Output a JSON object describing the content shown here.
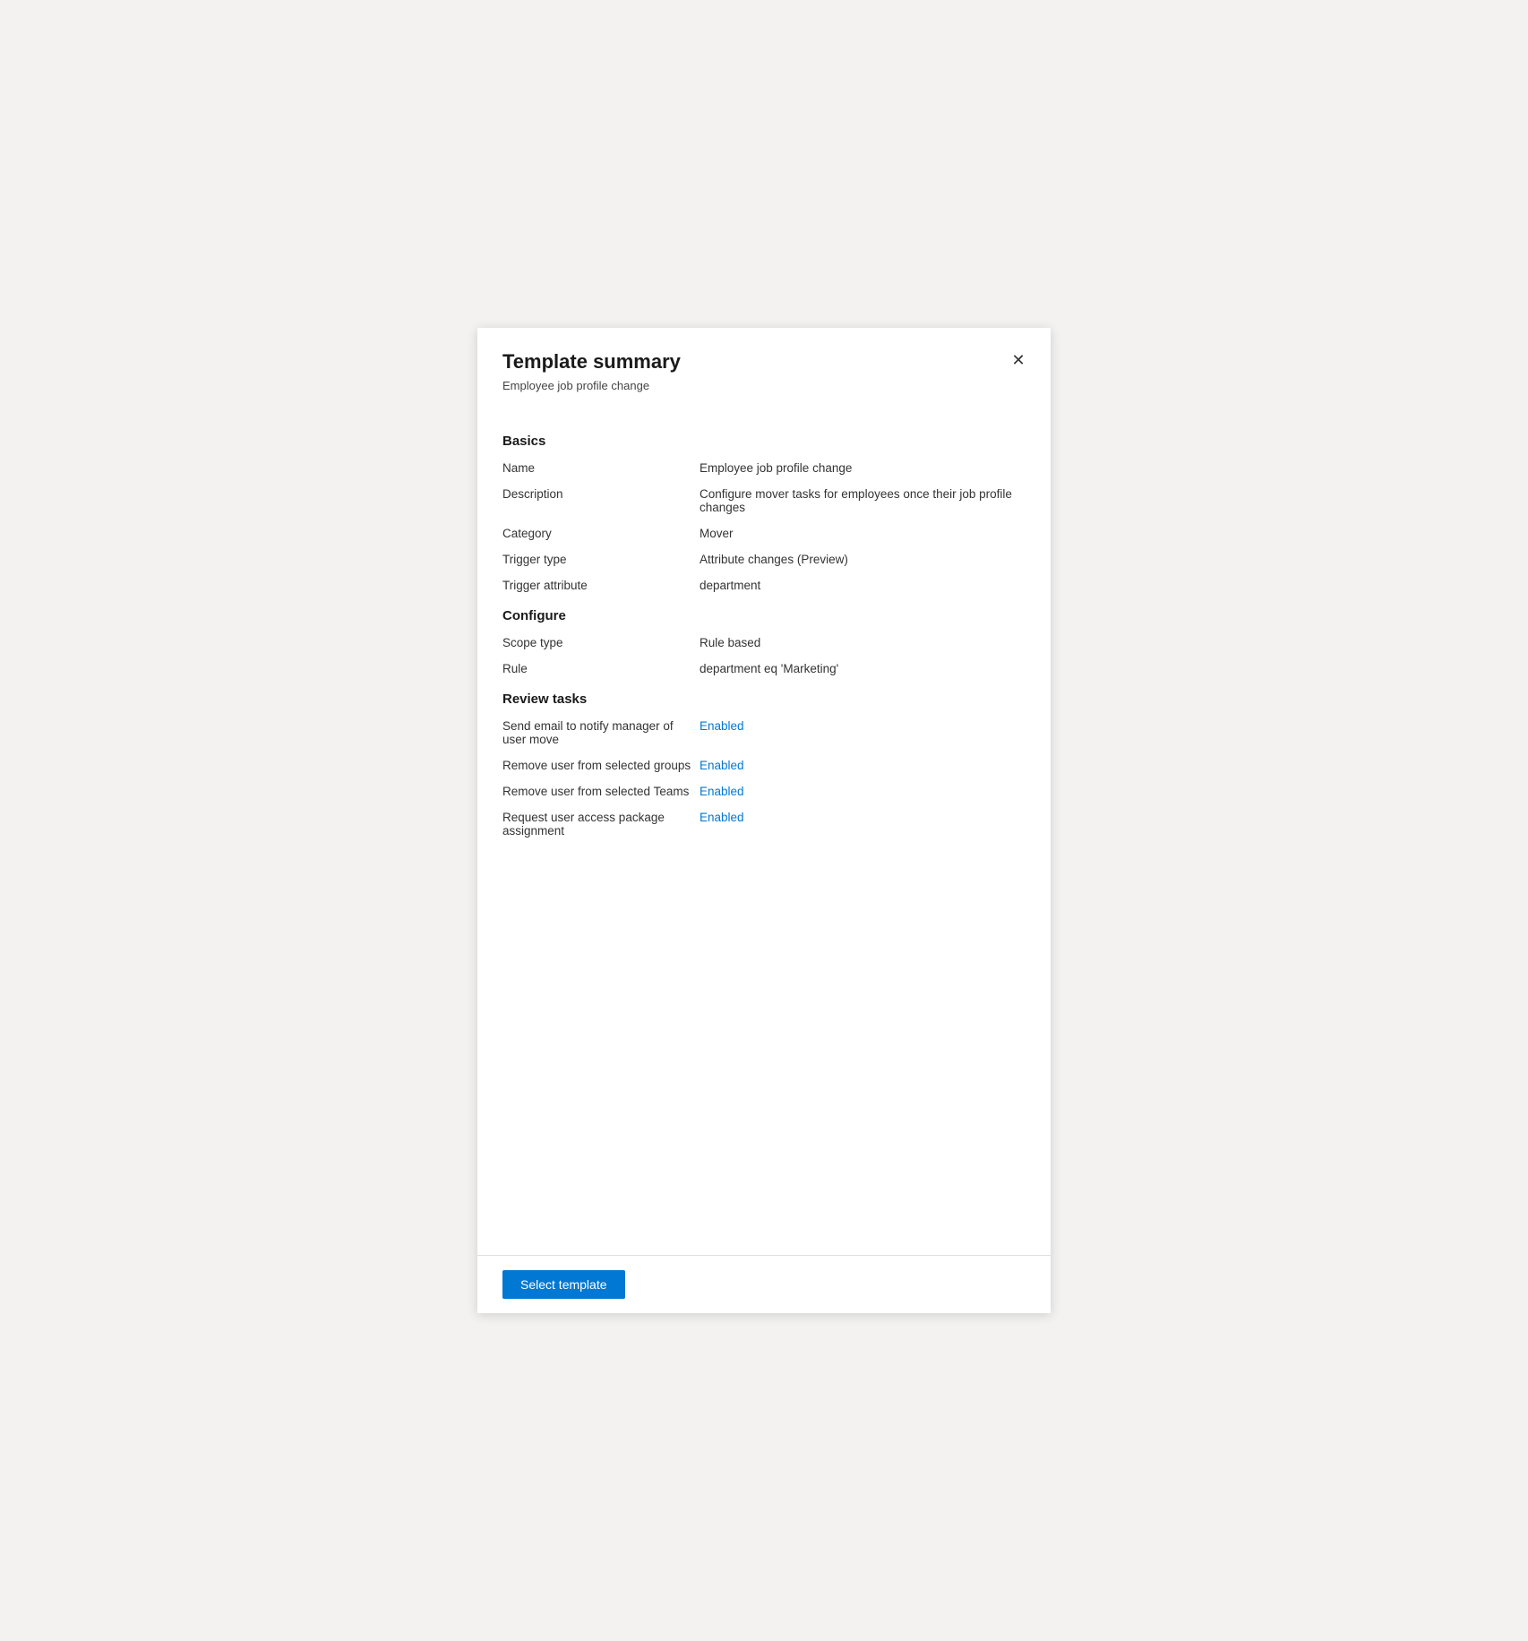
{
  "panel": {
    "title": "Template summary",
    "subtitle": "Employee job profile change",
    "close_icon": "✕"
  },
  "sections": {
    "basics": {
      "heading": "Basics",
      "fields": [
        {
          "label": "Name",
          "value": "Employee job profile change",
          "enabled": false
        },
        {
          "label": "Description",
          "value": "Configure mover tasks for employees once their job profile changes",
          "enabled": false
        },
        {
          "label": "Category",
          "value": "Mover",
          "enabled": false
        },
        {
          "label": "Trigger type",
          "value": "Attribute changes (Preview)",
          "enabled": false
        },
        {
          "label": "Trigger attribute",
          "value": "department",
          "enabled": false
        }
      ]
    },
    "configure": {
      "heading": "Configure",
      "fields": [
        {
          "label": "Scope type",
          "value": "Rule based",
          "enabled": false
        },
        {
          "label": "Rule",
          "value": "department eq 'Marketing'",
          "enabled": false
        }
      ]
    },
    "review_tasks": {
      "heading": "Review tasks",
      "fields": [
        {
          "label": "Send email to notify manager of user move",
          "value": "Enabled",
          "enabled": true
        },
        {
          "label": "Remove user from selected groups",
          "value": "Enabled",
          "enabled": true
        },
        {
          "label": "Remove user from selected Teams",
          "value": "Enabled",
          "enabled": true
        },
        {
          "label": "Request user access package assignment",
          "value": "Enabled",
          "enabled": true
        }
      ]
    }
  },
  "footer": {
    "select_template_label": "Select template"
  }
}
